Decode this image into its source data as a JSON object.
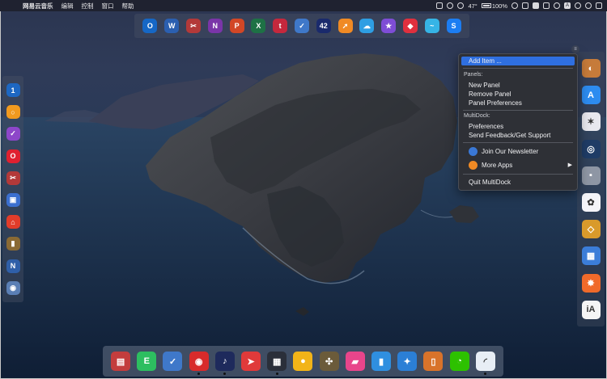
{
  "menubar": {
    "app_name": "网易云音乐",
    "menus": [
      "编辑",
      "控制",
      "窗口",
      "帮助"
    ],
    "temperature": "47°",
    "battery": "100%",
    "input_label": "A"
  },
  "top_dock": {
    "apps": [
      {
        "name": "Outlook",
        "glyph": "O",
        "color": "#1667c5"
      },
      {
        "name": "Word",
        "glyph": "W",
        "color": "#2b5fb0"
      },
      {
        "name": "Tool",
        "glyph": "✂",
        "color": "#b33939"
      },
      {
        "name": "OneNote",
        "glyph": "N",
        "color": "#7a35a8"
      },
      {
        "name": "PowerPoint",
        "glyph": "P",
        "color": "#d24726"
      },
      {
        "name": "Excel",
        "glyph": "X",
        "color": "#1e7145"
      },
      {
        "name": "Toolbox",
        "glyph": "t",
        "color": "#c5283d"
      },
      {
        "name": "Paw",
        "glyph": "✓",
        "color": "#3f78c9"
      },
      {
        "name": "42",
        "glyph": "42",
        "color": "#1a2a6c"
      },
      {
        "name": "Rocket",
        "glyph": "➚",
        "color": "#f08a24"
      },
      {
        "name": "Weather",
        "glyph": "☁",
        "color": "#2e9ee3"
      },
      {
        "name": "Star",
        "glyph": "★",
        "color": "#7e4dd6"
      },
      {
        "name": "Shield",
        "glyph": "◆",
        "color": "#e0303e"
      },
      {
        "name": "Cloud",
        "glyph": "~",
        "color": "#36b4e6"
      },
      {
        "name": "Shazam",
        "glyph": "S",
        "color": "#1c7df2"
      }
    ]
  },
  "left_dock": {
    "apps": [
      {
        "name": "1Password",
        "glyph": "1",
        "color": "#1d67c2"
      },
      {
        "name": "Circle",
        "glyph": "○",
        "color": "#f29a1f"
      },
      {
        "name": "Tasks",
        "glyph": "✓",
        "color": "#8d46c9"
      },
      {
        "name": "Opera",
        "glyph": "O",
        "color": "#e02030"
      },
      {
        "name": "Tool",
        "glyph": "✂",
        "color": "#b33939"
      },
      {
        "name": "Screen",
        "glyph": "▣",
        "color": "#3b6fcf"
      },
      {
        "name": "Home",
        "glyph": "⌂",
        "color": "#e23c2a"
      },
      {
        "name": "Notebook",
        "glyph": "▮",
        "color": "#8a6a34"
      },
      {
        "name": "NTFS",
        "glyph": "N",
        "color": "#2f5fa8"
      },
      {
        "name": "Disk",
        "glyph": "◉",
        "color": "#5a7fb5"
      }
    ]
  },
  "right_dock": {
    "apps": [
      {
        "name": "Keka",
        "glyph": "◐",
        "color": "#c67b3a"
      },
      {
        "name": "App Store",
        "glyph": "A",
        "color": "#2d8cf0"
      },
      {
        "name": "Spark",
        "glyph": "✶",
        "color": "#e8e8ee"
      },
      {
        "name": "Target",
        "glyph": "◎",
        "color": "#1f3c66"
      },
      {
        "name": "Robot",
        "glyph": "▪",
        "color": "#8e96a4"
      },
      {
        "name": "Pinwheel",
        "glyph": "✿",
        "color": "#f4f4f8"
      },
      {
        "name": "Sketch",
        "glyph": "◇",
        "color": "#d99a2b"
      },
      {
        "name": "Tiles",
        "glyph": "▦",
        "color": "#3b7dd8"
      },
      {
        "name": "Flower",
        "glyph": "✸",
        "color": "#f06a2a"
      },
      {
        "name": "iA Writer",
        "glyph": "iA",
        "color": "#f5f5f5"
      }
    ]
  },
  "bottom_dock": {
    "apps": [
      {
        "name": "Mosaic",
        "glyph": "▤",
        "color": "#c33d3d",
        "running": false
      },
      {
        "name": "Evernote",
        "glyph": "E",
        "color": "#2dbe60",
        "running": false
      },
      {
        "name": "Paw",
        "glyph": "✓",
        "color": "#3f78c9",
        "running": false
      },
      {
        "name": "NetEase Music",
        "glyph": "◉",
        "color": "#d82b2b",
        "running": true
      },
      {
        "name": "Music Bird",
        "glyph": "♪",
        "color": "#1e2a5c",
        "running": true
      },
      {
        "name": "Bird",
        "glyph": "➤",
        "color": "#e03a3a",
        "running": false
      },
      {
        "name": "Calculator",
        "glyph": "▦",
        "color": "#2a2f3a",
        "running": true
      },
      {
        "name": "Coin",
        "glyph": "●",
        "color": "#f2b418",
        "running": false
      },
      {
        "name": "Toolkit",
        "glyph": "✣",
        "color": "#6b5b3a",
        "running": false
      },
      {
        "name": "Eraser",
        "glyph": "▰",
        "color": "#e8458b",
        "running": false
      },
      {
        "name": "Bookmark",
        "glyph": "▮",
        "color": "#2f8fe0",
        "running": false
      },
      {
        "name": "Safari",
        "glyph": "✦",
        "color": "#2b7fd6",
        "running": false
      },
      {
        "name": "Door",
        "glyph": "▯",
        "color": "#d8732a",
        "running": false
      },
      {
        "name": "WeChat",
        "glyph": "◔",
        "color": "#2dc100",
        "running": false
      },
      {
        "name": "Loading",
        "glyph": "◜",
        "color": "#e8eef5",
        "running": true
      }
    ]
  },
  "context_menu": {
    "add_item": "Add Item ...",
    "panels_header": "Panels:",
    "new_panel": "New Panel",
    "remove_panel": "Remove Panel",
    "panel_preferences": "Panel Preferences",
    "multidock_header": "MultiDock:",
    "preferences": "Preferences",
    "send_feedback": "Send Feedback/Get Support",
    "join_newsletter": "Join Our Newsletter",
    "more_apps": "More Apps",
    "quit": "Quit MultiDock",
    "highlight_color": "#2f6fe0"
  }
}
